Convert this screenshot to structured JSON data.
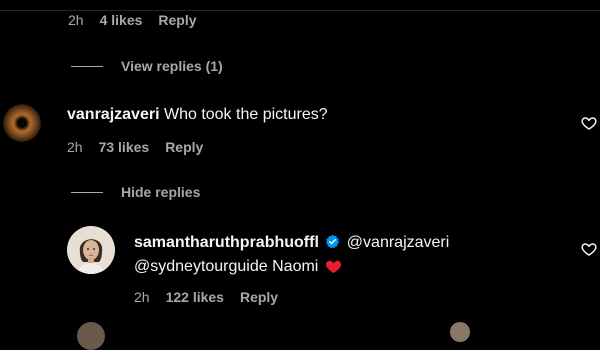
{
  "thread_top": {
    "time": "2h",
    "likes": "4 likes",
    "reply": "Reply",
    "view_replies": "View replies (1)"
  },
  "comment1": {
    "username": "vanrajzaveri",
    "text": "Who took the pictures?",
    "time": "2h",
    "likes": "73 likes",
    "reply": "Reply",
    "hide_replies": "Hide replies"
  },
  "reply1": {
    "username": "samantharuthprabhuoffl",
    "mention1": "@vanrajzaveri",
    "mention2": "@sydneytourguide",
    "text": "Naomi",
    "time": "2h",
    "likes": "122 likes",
    "reply": "Reply"
  },
  "colors": {
    "background": "#000000",
    "text": "#f5f5f5",
    "muted": "#a8a8a8",
    "verified": "#0095f6",
    "heart": "#ed1c2e"
  }
}
